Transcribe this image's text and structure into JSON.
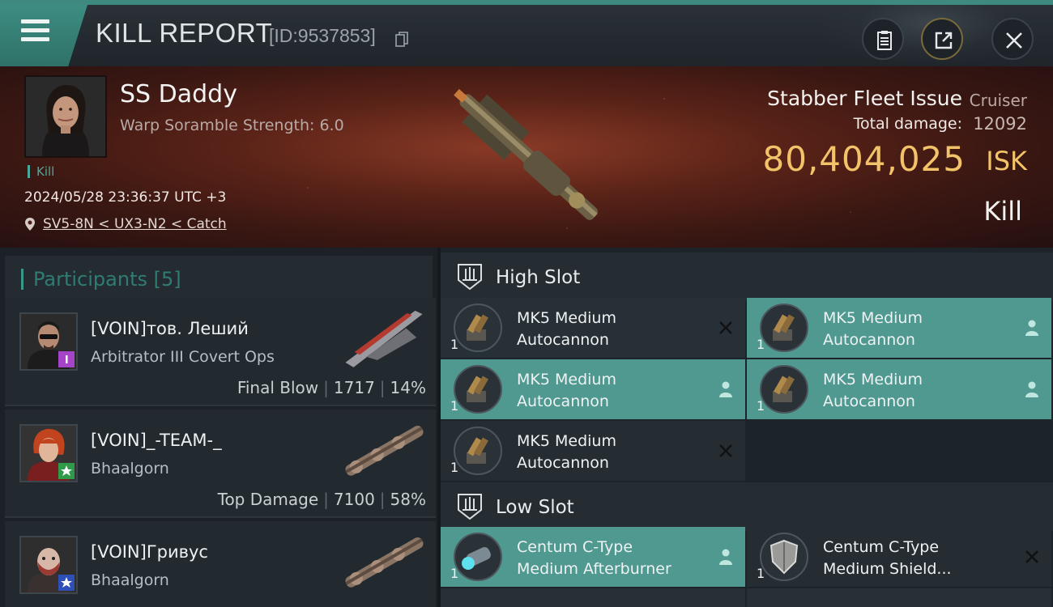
{
  "header": {
    "title": "KILL REPORT",
    "report_id": "[ID:9537853]"
  },
  "victim": {
    "name": "SS Daddy",
    "scramble": "Warp Soramble Strength: 6.0",
    "tag": "Kill",
    "timestamp": "2024/05/28 23:36:37 UTC +3",
    "location": "SV5-8N < UX3-N2 < Catch",
    "ship_name": "Stabber Fleet Issue",
    "ship_class": "Cruiser",
    "damage_label": "Total damage:",
    "damage_value": "12092",
    "isk_value": "80,404,025",
    "isk_unit": "ISK",
    "result": "Kill"
  },
  "participants": {
    "title": "Participants",
    "count": "[5]",
    "rows": [
      {
        "name": "[VOIN]тов. Леший",
        "ship": "Arbitrator III Covert Ops",
        "label": "Final Blow",
        "damage": "1717",
        "percent": "14%",
        "badge_color": "#a644c9"
      },
      {
        "name": "[VOIN]_-TEAM-_",
        "ship": "Bhaalgorn",
        "label": "Top Damage",
        "damage": "7100",
        "percent": "58%",
        "badge_color": "#2f9b4a"
      },
      {
        "name": "[VOIN]Гривус",
        "ship": "Bhaalgorn",
        "label": "",
        "damage": "",
        "percent": "",
        "badge_color": "#2c4fb8"
      }
    ]
  },
  "slots": {
    "high_title": "High Slot",
    "low_title": "Low Slot",
    "high": [
      {
        "line1": "MK5 Medium",
        "line2": "Autocannon",
        "qty": "1",
        "status": "destroyed"
      },
      {
        "line1": "MK5 Medium",
        "line2": "Autocannon",
        "qty": "1",
        "status": "dropped"
      },
      {
        "line1": "MK5 Medium",
        "line2": "Autocannon",
        "qty": "1",
        "status": "dropped"
      },
      {
        "line1": "MK5 Medium",
        "line2": "Autocannon",
        "qty": "1",
        "status": "dropped"
      },
      {
        "line1": "MK5 Medium",
        "line2": "Autocannon",
        "qty": "1",
        "status": "destroyed"
      }
    ],
    "low": [
      {
        "line1": "Centum C-Type",
        "line2": "Medium Afterburner",
        "qty": "1",
        "status": "dropped"
      },
      {
        "line1": "Centum C-Type",
        "line2": "Medium Shield...",
        "qty": "1",
        "status": "destroyed"
      }
    ]
  },
  "icons": {
    "menu": "hamburger-menu-icon",
    "copy": "copy-icon",
    "clipboard": "clipboard-icon",
    "share": "share-icon",
    "close": "close-icon",
    "location": "location-pin-icon",
    "slot": "turret-slot-icon",
    "dropped": "person-icon",
    "destroyed": "x-mark-icon"
  },
  "colors": {
    "accent": "#3f8a80",
    "isk": "#f2c368",
    "active_module": "#4f9990"
  }
}
